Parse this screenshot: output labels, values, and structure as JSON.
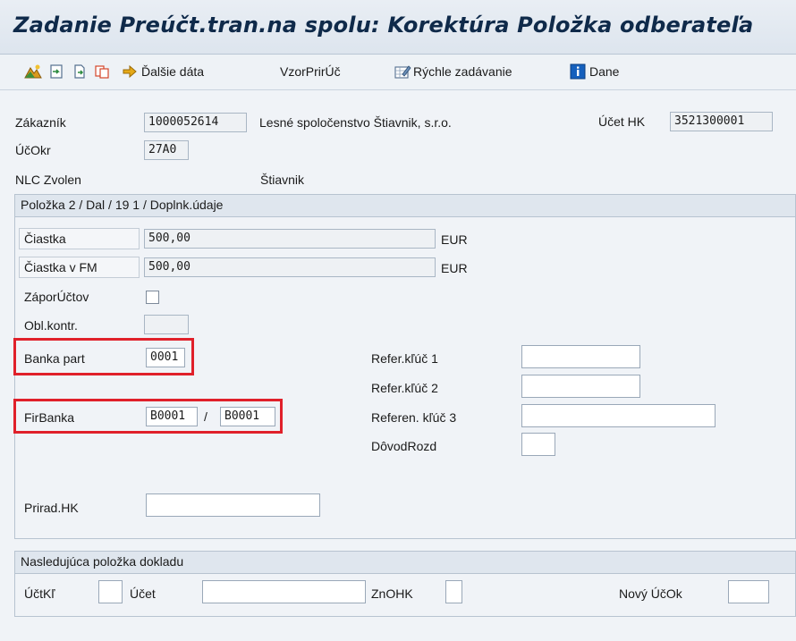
{
  "window": {
    "title": "Zadanie Preúčt.tran.na spolu: Korektúra Položka odberateľa"
  },
  "toolbar": {
    "more_data_label": "Ďalšie dáta",
    "template_label": "VzorPrirÚč",
    "fast_entry_label": "Rýchle zadávanie",
    "taxes_label": "Dane"
  },
  "header": {
    "customer_label": "Zákazník",
    "customer_value": "1000052614",
    "customer_name": "Lesné spoločenstvo Štiavnik, s.r.o.",
    "gl_account_label": "Účet HK",
    "gl_account_value": "3521300001",
    "company_code_label": "ÚčOkr",
    "company_code_value": "27A0",
    "city_left": "NLC Zvolen",
    "city_right": "Štiavnik"
  },
  "item_group": {
    "title": "Položka 2 / Dal / 19 1 / Doplnk.údaje",
    "amount_label": "Čiastka",
    "amount_value": "500,00",
    "amount_currency": "EUR",
    "amount_lc_label": "Čiastka v FM",
    "amount_lc_value": "500,00",
    "amount_lc_currency": "EUR",
    "neg_posting_label": "ZáporÚčtov",
    "neg_posting_checked": false,
    "control_area_label": "Obl.kontr.",
    "control_area_value": "",
    "partner_bank_label": "Banka part",
    "partner_bank_value": "0001",
    "house_bank_label": "FirBanka",
    "house_bank_value": "B0001",
    "house_bank_sep": "/",
    "house_bank_account_value": "B0001",
    "ref_key1_label": "Refer.kľúč 1",
    "ref_key1_value": "",
    "ref_key2_label": "Refer.kľúč 2",
    "ref_key2_value": "",
    "ref_key3_label": "Referen. kľúč 3",
    "ref_key3_value": "",
    "reason_label": "DôvodRozd",
    "reason_value": "",
    "assign_gl_label": "Prirad.HK",
    "assign_gl_value": ""
  },
  "next_item_group": {
    "title": "Nasledujúca položka dokladu",
    "posting_key_label": "ÚčtKľ",
    "posting_key_value": "",
    "account_label": "Účet",
    "account_value": "",
    "special_gl_label": "ZnOHK",
    "special_gl_value": "",
    "new_company_code_label": "Nový ÚčOk",
    "new_company_code_value": ""
  },
  "colors": {
    "highlight": "#e0202a",
    "title": "#0f2a4a",
    "info_icon": "#1560bd"
  }
}
